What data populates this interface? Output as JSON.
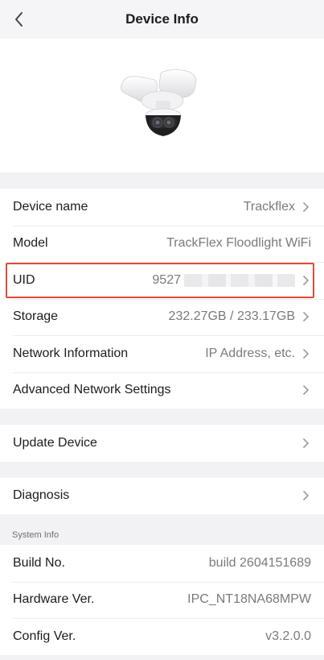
{
  "header": {
    "title": "Device Info"
  },
  "device_section": [
    {
      "label": "Device name",
      "value": "Trackflex",
      "chevron": true
    },
    {
      "label": "Model",
      "value": "TrackFlex Floodlight WiFi",
      "chevron": false
    },
    {
      "label": "UID",
      "value": "9527",
      "chevron": true,
      "redacted": true,
      "highlighted": true
    },
    {
      "label": "Storage",
      "value": "232.27GB / 233.17GB",
      "chevron": true
    },
    {
      "label": "Network Information",
      "value": "IP Address, etc.",
      "chevron": true
    },
    {
      "label": "Advanced Network Settings",
      "value": "",
      "chevron": true
    }
  ],
  "update": {
    "label": "Update Device"
  },
  "diagnosis": {
    "label": "Diagnosis"
  },
  "system_info": {
    "heading": "System Info",
    "rows": [
      {
        "label": "Build No.",
        "value": "build 2604151689"
      },
      {
        "label": "Hardware Ver.",
        "value": "IPC_NT18NA68MPW"
      },
      {
        "label": "Config Ver.",
        "value": "v3.2.0.0"
      }
    ]
  },
  "colors": {
    "highlight": "#e0493c",
    "chevron": "#9a9a9e"
  },
  "icons": {
    "back": "chevron-left-icon",
    "disclosure": "chevron-right-icon",
    "device": "floodlight-camera-image"
  }
}
